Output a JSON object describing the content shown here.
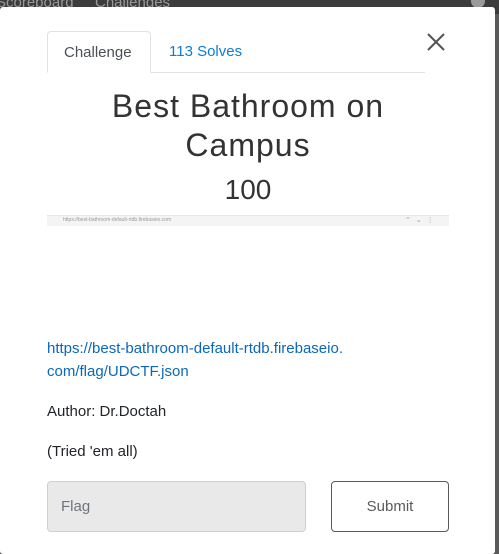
{
  "background_nav": {
    "items": [
      "Scoreboard",
      "Challenges"
    ]
  },
  "tabs": {
    "challenge_label": "Challenge",
    "solves_label": "113 Solves"
  },
  "close_icon": "close-icon",
  "challenge": {
    "title": "Best Bathroom on Campus",
    "value": "100",
    "link": "https://best-bathroom-default-rtdb.firebaseio.com/flag/UDCTF.json",
    "author": "Author: Dr.Doctah",
    "description": "(Tried 'em all)"
  },
  "embedded_screenshot": {
    "url_text": "https://best-bathroom-default-rtdb.firebaseio.com"
  },
  "form": {
    "flag_placeholder": "Flag",
    "flag_value": "",
    "submit_label": "Submit"
  },
  "colors": {
    "link": "#0b68b8",
    "tab_active_text": "#495057",
    "overlay": "#5a5a5a"
  }
}
